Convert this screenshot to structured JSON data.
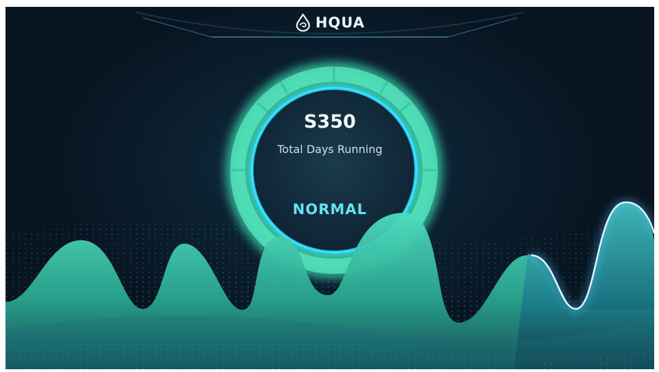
{
  "header": {
    "brand": "HQUA",
    "logo_icon": "water-drop-icon"
  },
  "dashboard": {
    "days_value": "S350",
    "days_label": "Total Days Running",
    "status": "NORMAL"
  },
  "colors": {
    "background": "#0c2232",
    "ring_glow": "#3fd8b4",
    "ring_inner": "#23c4e0",
    "wave_fill": "#37c6a6",
    "wave_highlight": "#4fb4ff",
    "status_text": "#63e2ee"
  }
}
